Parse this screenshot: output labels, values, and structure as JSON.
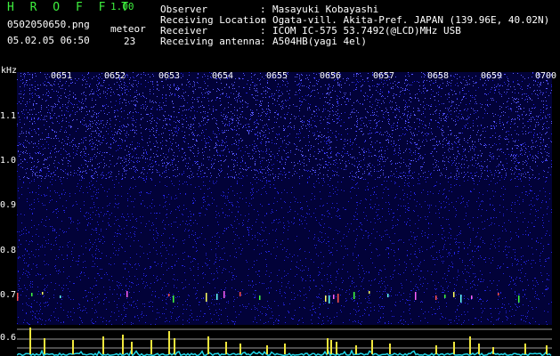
{
  "header": {
    "app_title": "H R O F F T",
    "app_version": "1.00",
    "file_name": "0502050650.png",
    "date_time": "05.02.05 06:50",
    "meteor_label": "meteor",
    "meteor_count": "23"
  },
  "info": [
    {
      "label": "Observer",
      "value": "Masayuki Kobayashi"
    },
    {
      "label": "Receiving Location",
      "value": "Ogata-vill. Akita-Pref. JAPAN (139.96E, 40.02N)"
    },
    {
      "label": "Receiver",
      "value": "ICOM IC-575 53.7492(@LCD)MHz USB"
    },
    {
      "label": "Receiving antenna",
      "value": "A504HB(yagi 4el)"
    }
  ],
  "info_separator": ":",
  "axis": {
    "y_unit": "kHz",
    "y_ticks": [
      "1.1",
      "1.0",
      "0.9",
      "0.8",
      "0.7",
      "0.6"
    ],
    "x_ticks": [
      "0651",
      "0652",
      "0653",
      "0654",
      "0655",
      "0656",
      "0657",
      "0658",
      "0659",
      "0700"
    ]
  },
  "colors": {
    "title_green": "#3ef03e",
    "spectrum_bg": "#020238",
    "noise_blue": "#2a2aff",
    "trace_cyan": "#22d6e8",
    "spike_yellow": "#f0e63c",
    "grid_gray": "#9a9a9a"
  }
}
